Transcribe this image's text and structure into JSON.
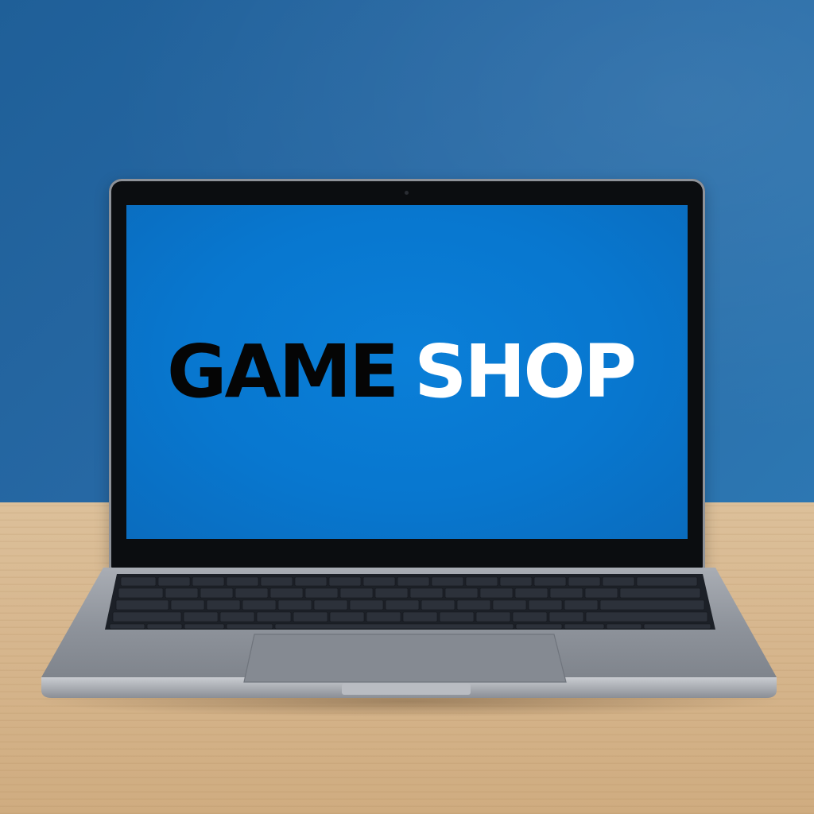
{
  "screen": {
    "logo": {
      "word_1": "GAME",
      "word_2": "SHOP"
    },
    "background_color": "#0a7fd8"
  },
  "colors": {
    "wall": "#2668a4",
    "desk": "#d7b78f",
    "laptop_body": "#8e939b",
    "logo_word_1": "#050505",
    "logo_word_2": "#ffffff"
  }
}
